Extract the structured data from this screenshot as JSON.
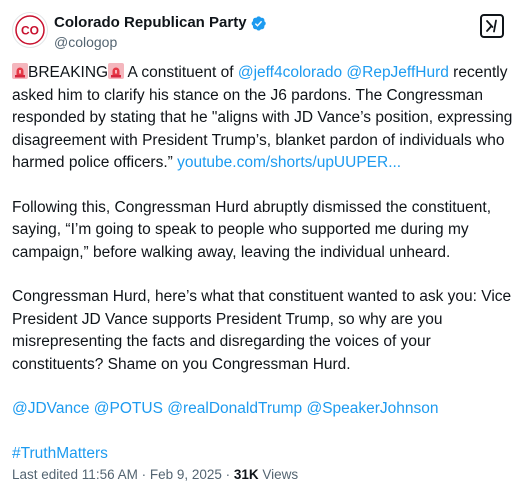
{
  "account": {
    "display_name": "Colorado Republican Party",
    "handle": "@cologop",
    "avatar_text": "CO"
  },
  "post": {
    "p1": {
      "emoji": "🚨",
      "breaking": "BREAKING",
      "text_a": " A constituent of ",
      "mention1": "@jeff4colorado",
      "space": " ",
      "mention2": "@RepJeffHurd",
      "text_b": " recently asked him to clarify his stance on the J6 pardons. The Congressman responded by stating that he \"aligns with JD Vance’s position, expressing disagreement with President Trump’s, blanket pardon of individuals who harmed police officers.”  ",
      "link": "youtube.com/shorts/upUUPER..."
    },
    "p2": "Following this, Congressman Hurd abruptly dismissed the constituent, saying, “I’m going to speak to people who supported me during my campaign,” before walking away, leaving the individual unheard.",
    "p3": "Congressman Hurd, here’s what that constituent wanted to ask you: Vice President JD Vance supports President Trump, so why are you misrepresenting the facts and disregarding the voices of your constituents? Shame on you Congressman Hurd.",
    "mentions": [
      "@JDVance",
      "@POTUS",
      "@realDonaldTrump",
      "@SpeakerJohnson"
    ],
    "hashtag": "#TruthMatters"
  },
  "meta": {
    "edited": "Last edited 11:56 AM · Feb 9, 2025 · ",
    "views_count": "31K",
    "views_label": " Views"
  },
  "colors": {
    "link": "#1d9bf0",
    "text": "#0f1419",
    "muted": "#536471",
    "verified": "#1d9bf0",
    "avatar_red": "#c8102e"
  },
  "icons": [
    "verified-badge-icon",
    "grok-icon",
    "siren-icon"
  ]
}
